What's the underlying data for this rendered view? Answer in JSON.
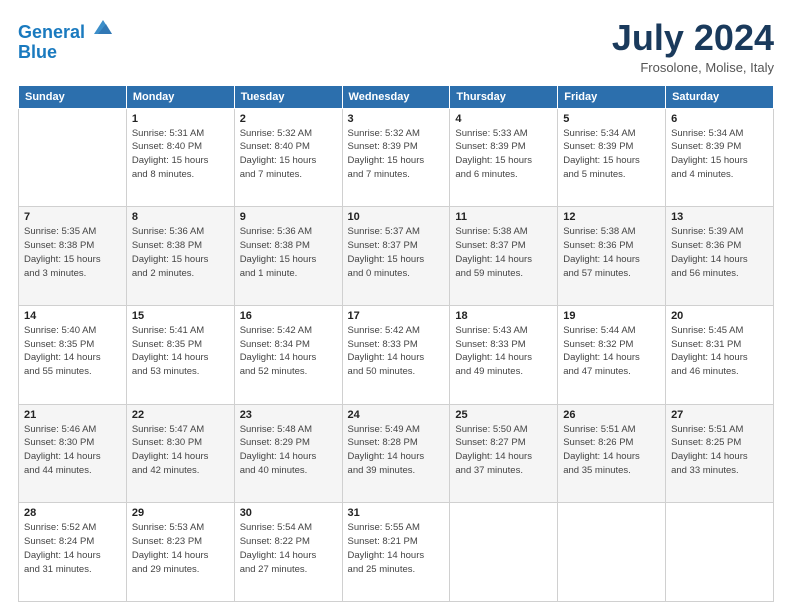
{
  "header": {
    "logo_line1": "General",
    "logo_line2": "Blue",
    "month_year": "July 2024",
    "location": "Frosolone, Molise, Italy"
  },
  "weekdays": [
    "Sunday",
    "Monday",
    "Tuesday",
    "Wednesday",
    "Thursday",
    "Friday",
    "Saturday"
  ],
  "weeks": [
    [
      {
        "day": "",
        "info": ""
      },
      {
        "day": "1",
        "info": "Sunrise: 5:31 AM\nSunset: 8:40 PM\nDaylight: 15 hours\nand 8 minutes."
      },
      {
        "day": "2",
        "info": "Sunrise: 5:32 AM\nSunset: 8:40 PM\nDaylight: 15 hours\nand 7 minutes."
      },
      {
        "day": "3",
        "info": "Sunrise: 5:32 AM\nSunset: 8:39 PM\nDaylight: 15 hours\nand 7 minutes."
      },
      {
        "day": "4",
        "info": "Sunrise: 5:33 AM\nSunset: 8:39 PM\nDaylight: 15 hours\nand 6 minutes."
      },
      {
        "day": "5",
        "info": "Sunrise: 5:34 AM\nSunset: 8:39 PM\nDaylight: 15 hours\nand 5 minutes."
      },
      {
        "day": "6",
        "info": "Sunrise: 5:34 AM\nSunset: 8:39 PM\nDaylight: 15 hours\nand 4 minutes."
      }
    ],
    [
      {
        "day": "7",
        "info": "Sunrise: 5:35 AM\nSunset: 8:38 PM\nDaylight: 15 hours\nand 3 minutes."
      },
      {
        "day": "8",
        "info": "Sunrise: 5:36 AM\nSunset: 8:38 PM\nDaylight: 15 hours\nand 2 minutes."
      },
      {
        "day": "9",
        "info": "Sunrise: 5:36 AM\nSunset: 8:38 PM\nDaylight: 15 hours\nand 1 minute."
      },
      {
        "day": "10",
        "info": "Sunrise: 5:37 AM\nSunset: 8:37 PM\nDaylight: 15 hours\nand 0 minutes."
      },
      {
        "day": "11",
        "info": "Sunrise: 5:38 AM\nSunset: 8:37 PM\nDaylight: 14 hours\nand 59 minutes."
      },
      {
        "day": "12",
        "info": "Sunrise: 5:38 AM\nSunset: 8:36 PM\nDaylight: 14 hours\nand 57 minutes."
      },
      {
        "day": "13",
        "info": "Sunrise: 5:39 AM\nSunset: 8:36 PM\nDaylight: 14 hours\nand 56 minutes."
      }
    ],
    [
      {
        "day": "14",
        "info": "Sunrise: 5:40 AM\nSunset: 8:35 PM\nDaylight: 14 hours\nand 55 minutes."
      },
      {
        "day": "15",
        "info": "Sunrise: 5:41 AM\nSunset: 8:35 PM\nDaylight: 14 hours\nand 53 minutes."
      },
      {
        "day": "16",
        "info": "Sunrise: 5:42 AM\nSunset: 8:34 PM\nDaylight: 14 hours\nand 52 minutes."
      },
      {
        "day": "17",
        "info": "Sunrise: 5:42 AM\nSunset: 8:33 PM\nDaylight: 14 hours\nand 50 minutes."
      },
      {
        "day": "18",
        "info": "Sunrise: 5:43 AM\nSunset: 8:33 PM\nDaylight: 14 hours\nand 49 minutes."
      },
      {
        "day": "19",
        "info": "Sunrise: 5:44 AM\nSunset: 8:32 PM\nDaylight: 14 hours\nand 47 minutes."
      },
      {
        "day": "20",
        "info": "Sunrise: 5:45 AM\nSunset: 8:31 PM\nDaylight: 14 hours\nand 46 minutes."
      }
    ],
    [
      {
        "day": "21",
        "info": "Sunrise: 5:46 AM\nSunset: 8:30 PM\nDaylight: 14 hours\nand 44 minutes."
      },
      {
        "day": "22",
        "info": "Sunrise: 5:47 AM\nSunset: 8:30 PM\nDaylight: 14 hours\nand 42 minutes."
      },
      {
        "day": "23",
        "info": "Sunrise: 5:48 AM\nSunset: 8:29 PM\nDaylight: 14 hours\nand 40 minutes."
      },
      {
        "day": "24",
        "info": "Sunrise: 5:49 AM\nSunset: 8:28 PM\nDaylight: 14 hours\nand 39 minutes."
      },
      {
        "day": "25",
        "info": "Sunrise: 5:50 AM\nSunset: 8:27 PM\nDaylight: 14 hours\nand 37 minutes."
      },
      {
        "day": "26",
        "info": "Sunrise: 5:51 AM\nSunset: 8:26 PM\nDaylight: 14 hours\nand 35 minutes."
      },
      {
        "day": "27",
        "info": "Sunrise: 5:51 AM\nSunset: 8:25 PM\nDaylight: 14 hours\nand 33 minutes."
      }
    ],
    [
      {
        "day": "28",
        "info": "Sunrise: 5:52 AM\nSunset: 8:24 PM\nDaylight: 14 hours\nand 31 minutes."
      },
      {
        "day": "29",
        "info": "Sunrise: 5:53 AM\nSunset: 8:23 PM\nDaylight: 14 hours\nand 29 minutes."
      },
      {
        "day": "30",
        "info": "Sunrise: 5:54 AM\nSunset: 8:22 PM\nDaylight: 14 hours\nand 27 minutes."
      },
      {
        "day": "31",
        "info": "Sunrise: 5:55 AM\nSunset: 8:21 PM\nDaylight: 14 hours\nand 25 minutes."
      },
      {
        "day": "",
        "info": ""
      },
      {
        "day": "",
        "info": ""
      },
      {
        "day": "",
        "info": ""
      }
    ]
  ]
}
